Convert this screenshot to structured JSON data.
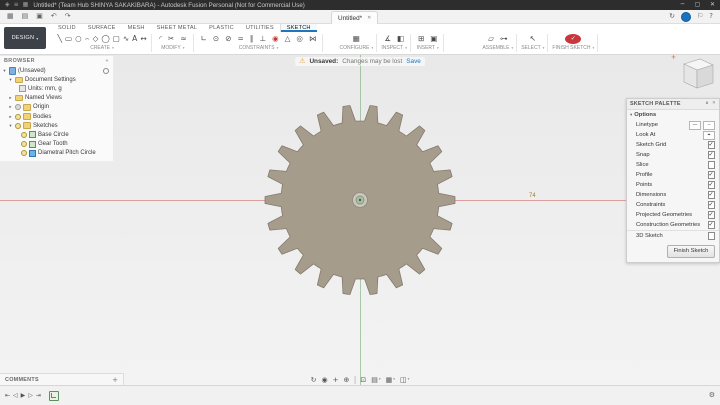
{
  "window": {
    "title": "Untitled* (Team Hub SHINYA SAKAKIBARA) - Autodesk Fusion Personal (Not for Commercial Use)",
    "menu_icons": [
      {
        "name": "app-logo-icon",
        "glyph": "◈"
      },
      {
        "name": "app-menu-icon",
        "glyph": "≡"
      },
      {
        "name": "window-switch-icon",
        "glyph": "▦"
      }
    ],
    "controls": [
      {
        "name": "minimize-button",
        "glyph": "─"
      },
      {
        "name": "maximize-button",
        "glyph": "▢"
      },
      {
        "name": "close-button",
        "glyph": "✕"
      }
    ]
  },
  "qat": {
    "icons": [
      {
        "name": "data-panel-icon",
        "glyph": "▦"
      },
      {
        "name": "file-menu-icon",
        "glyph": "▤"
      },
      {
        "name": "save-icon",
        "glyph": "▣"
      },
      {
        "name": "undo-icon",
        "glyph": "↶"
      },
      {
        "name": "redo-icon",
        "glyph": "↷"
      }
    ],
    "doc_tab": {
      "label": "Untitled*",
      "close_glyph": "✕"
    },
    "right_icons": [
      {
        "name": "job-status-icon",
        "glyph": "↻"
      },
      {
        "name": "user-avatar",
        "glyph": "",
        "cls": "avatar"
      },
      {
        "name": "notification-icon",
        "glyph": "⚐"
      },
      {
        "name": "help-icon",
        "glyph": "?"
      }
    ]
  },
  "workspace": {
    "label": "DESIGN"
  },
  "ribbon": {
    "tabs": [
      {
        "name": "tab-solid",
        "label": "SOLID"
      },
      {
        "name": "tab-surface",
        "label": "SURFACE"
      },
      {
        "name": "tab-mesh",
        "label": "MESH"
      },
      {
        "name": "tab-sheet-metal",
        "label": "SHEET METAL"
      },
      {
        "name": "tab-plastic",
        "label": "PLASTIC"
      },
      {
        "name": "tab-utilities",
        "label": "UTILITIES"
      },
      {
        "name": "tab-sketch",
        "label": "SKETCH",
        "cls": "active"
      }
    ],
    "groups": [
      {
        "label": "CREATE",
        "icons": [
          {
            "name": "line-icon",
            "glyph": "╲"
          },
          {
            "name": "rectangle-icon",
            "glyph": "▭"
          },
          {
            "name": "circle-icon",
            "glyph": "○"
          },
          {
            "name": "arc-icon",
            "glyph": "⌢"
          },
          {
            "name": "polygon-icon",
            "glyph": "◇"
          },
          {
            "name": "ellipse-icon",
            "glyph": "◯"
          },
          {
            "name": "slot-icon",
            "glyph": "▢"
          },
          {
            "name": "spline-icon",
            "glyph": "∿"
          },
          {
            "name": "text-icon",
            "glyph": "A"
          },
          {
            "name": "dimension-icon",
            "glyph": "↔"
          }
        ]
      },
      {
        "label": "MODIFY",
        "icons": [
          {
            "name": "fillet-icon",
            "glyph": "◜"
          },
          {
            "name": "trim-icon",
            "glyph": "✂"
          },
          {
            "name": "offset-icon",
            "glyph": "≈"
          }
        ]
      },
      {
        "label": "CONSTRAINTS",
        "icons": [
          {
            "name": "horizontal-vertical-constraint-icon",
            "glyph": "∟"
          },
          {
            "name": "coincident-constraint-icon",
            "glyph": "⊙"
          },
          {
            "name": "tangent-constraint-icon",
            "glyph": "⊘"
          },
          {
            "name": "equal-constraint-icon",
            "glyph": "="
          },
          {
            "name": "parallel-constraint-icon",
            "glyph": "∥"
          },
          {
            "name": "perpendicular-constraint-icon",
            "glyph": "⊥"
          },
          {
            "name": "fix-lock-constraint-icon",
            "glyph": "◉",
            "cls": "red"
          },
          {
            "name": "midpoint-constraint-icon",
            "glyph": "△"
          },
          {
            "name": "concentric-constraint-icon",
            "glyph": "◎"
          },
          {
            "name": "symmetry-constraint-icon",
            "glyph": "⋈"
          }
        ]
      },
      {
        "label": "CONFIGURE",
        "icons": [
          {
            "name": "configure-icon",
            "glyph": "▦"
          }
        ]
      },
      {
        "label": "INSPECT",
        "icons": [
          {
            "name": "measure-icon",
            "glyph": "∡"
          },
          {
            "name": "section-analysis-icon",
            "glyph": "◧"
          }
        ]
      },
      {
        "label": "INSERT",
        "icons": [
          {
            "name": "insert-icon",
            "glyph": "⊞"
          },
          {
            "name": "decal-icon",
            "glyph": "▣"
          }
        ]
      },
      {
        "label": "ASSEMBLE",
        "icons": [
          {
            "name": "new-component-icon",
            "glyph": "▱"
          },
          {
            "name": "joint-icon",
            "glyph": "⊶"
          }
        ]
      },
      {
        "label": "SELECT",
        "icons": [
          {
            "name": "select-icon",
            "glyph": "↖"
          }
        ]
      },
      {
        "label": "FINISH SKETCH",
        "icons": [
          {
            "name": "finish-sketch-icon",
            "glyph": "✓",
            "cls": "finish"
          }
        ]
      }
    ]
  },
  "warning": {
    "icon": "⚠",
    "label": "Unsaved:",
    "message": "Changes may be lost",
    "action": "Save"
  },
  "browser": {
    "header": {
      "title": "BROWSER",
      "dock_glyph": "«"
    },
    "rows": [
      {
        "label": "(Unsaved)"
      },
      {
        "label": "Document Settings"
      },
      {
        "label": "Units: mm, g"
      },
      {
        "label": "Named Views"
      },
      {
        "label": "Origin"
      },
      {
        "label": "Bodies"
      },
      {
        "label": "Sketches"
      },
      {
        "label": "Base Circle"
      },
      {
        "label": "Gear Tooth"
      },
      {
        "label": "Diametral Pitch Circle"
      }
    ]
  },
  "canvas": {
    "dimension_label": "74"
  },
  "gear": {
    "teeth": 22,
    "outer_radius": 95,
    "root_radius": 79,
    "fill": "#a69c8c",
    "stroke": "#837a6d"
  },
  "palette": {
    "header": {
      "title": "SKETCH PALETTE",
      "collapse_glyph": "∧",
      "close_glyph": "✕"
    },
    "section": "Options",
    "rows": [
      {
        "label": "Linetype"
      },
      {
        "label": "Look At"
      },
      {
        "label": "Sketch Grid",
        "checked": true
      },
      {
        "label": "Snap",
        "checked": true
      },
      {
        "label": "Slice",
        "checked": false
      },
      {
        "label": "Profile",
        "checked": true
      },
      {
        "label": "Points",
        "checked": true
      },
      {
        "label": "Dimensions",
        "checked": true
      },
      {
        "label": "Constraints",
        "checked": true
      },
      {
        "label": "Projected Geometries",
        "checked": true
      },
      {
        "label": "Construction Geometries",
        "checked": true
      },
      {
        "label": "3D Sketch",
        "checked": false
      }
    ],
    "linetype_icons": [
      {
        "name": "solid-linetype-icon",
        "glyph": "—"
      },
      {
        "name": "construction-linetype-icon",
        "glyph": "╌"
      }
    ],
    "look_at_icon": {
      "name": "look-at-target-icon",
      "glyph": "⌖"
    },
    "finish_button": "Finish Sketch"
  },
  "navbar": {
    "icons": [
      {
        "name": "orbit-icon",
        "glyph": "↻"
      },
      {
        "name": "look-at-icon",
        "glyph": "◉"
      },
      {
        "name": "pan-icon",
        "glyph": "+"
      },
      {
        "name": "zoom-icon",
        "glyph": "⊕"
      },
      {
        "name": "separator",
        "glyph": "",
        "cls": "sep"
      },
      {
        "name": "fit-icon",
        "glyph": "⊡"
      },
      {
        "name": "display-settings-icon",
        "glyph": "▤",
        "cls": "dd"
      },
      {
        "name": "grid-settings-icon",
        "glyph": "▦",
        "cls": "dd"
      },
      {
        "name": "viewports-icon",
        "glyph": "◫",
        "cls": "dd"
      }
    ]
  },
  "comments": {
    "label": "COMMENTS",
    "add_glyph": "+"
  },
  "timeline": {
    "controls": [
      {
        "name": "go-to-start-icon",
        "glyph": "⇤"
      },
      {
        "name": "step-back-icon",
        "glyph": "◁"
      },
      {
        "name": "play-icon",
        "glyph": "▶"
      },
      {
        "name": "step-forward-icon",
        "glyph": "▷"
      },
      {
        "name": "go-to-end-icon",
        "glyph": "⇥"
      }
    ],
    "settings_glyph": "⚙"
  }
}
